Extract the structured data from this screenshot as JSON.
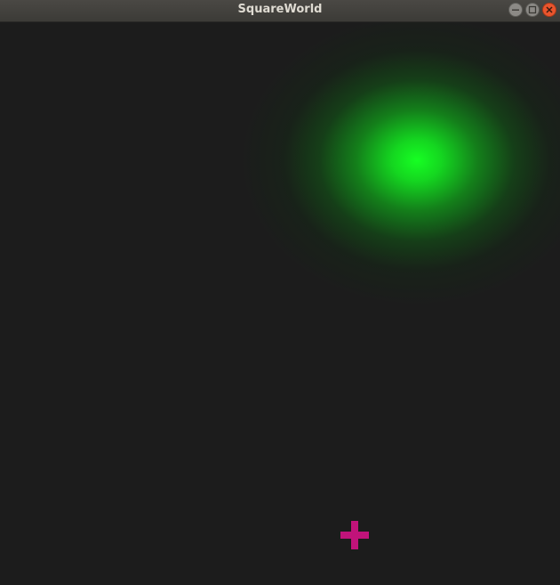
{
  "window": {
    "title": "SquareWorld",
    "buttons": {
      "minimize": "minimize-icon",
      "maximize": "maximize-icon",
      "close": "close-icon"
    }
  },
  "game": {
    "background_color": "#1c1c1c",
    "target": {
      "type": "glow",
      "color": "#16ff23"
    },
    "player": {
      "shape": "plus",
      "color": "#c0137a"
    }
  }
}
